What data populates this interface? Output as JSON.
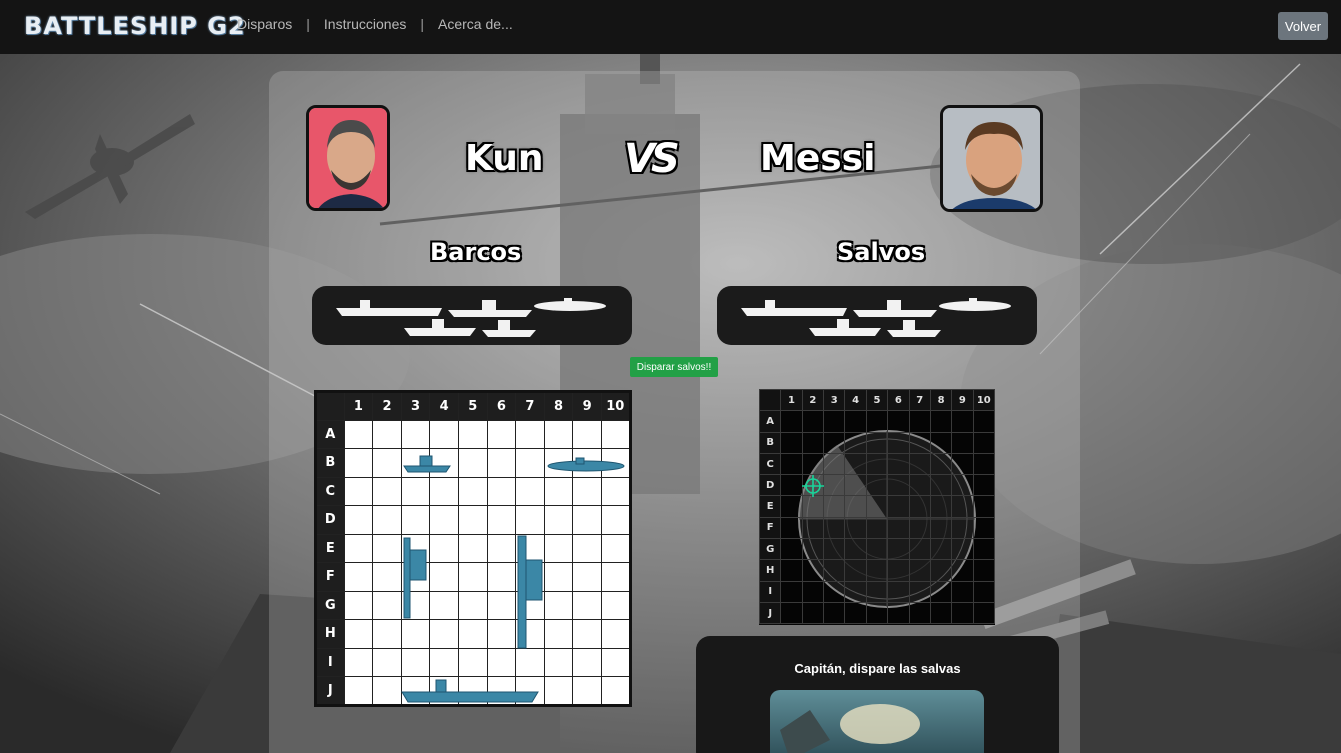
{
  "navbar": {
    "brand": "BATTLESHIP G2",
    "links": [
      "Disparos",
      "Instrucciones",
      "Acerca de..."
    ],
    "separator": "|",
    "back_button": "Volver"
  },
  "players": {
    "left": {
      "name": "Kun"
    },
    "vs": "VS",
    "right": {
      "name": "Messi"
    }
  },
  "sections": {
    "ships_title": "Barcos",
    "salvos_title": "Salvos"
  },
  "actions": {
    "fire_button": "Disparar salvos!!"
  },
  "board": {
    "columns": [
      "1",
      "2",
      "3",
      "4",
      "5",
      "6",
      "7",
      "8",
      "9",
      "10"
    ],
    "rows": [
      "A",
      "B",
      "C",
      "D",
      "E",
      "F",
      "G",
      "H",
      "I",
      "J"
    ]
  },
  "captain_card": {
    "text": "Capitán, dispare las salvas"
  },
  "colors": {
    "fire_button": "#22a046",
    "back_button": "#6c757d",
    "ship_blue": "#3b87a6",
    "radar_green": "#19d49a"
  }
}
